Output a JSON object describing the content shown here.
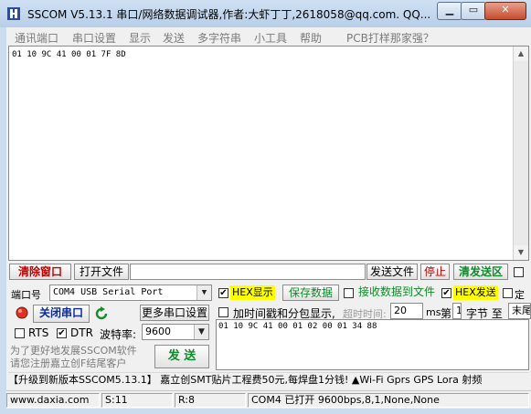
{
  "window": {
    "title": "SSCOM V5.13.1 串口/网络数据调试器,作者:大虾丁丁,2618058@qq.com. QQ...",
    "minimize_icon": "minimize-icon",
    "maximize_icon": "maximize-icon",
    "close_icon": "close-icon"
  },
  "menu": [
    "通讯端口",
    "串口设置",
    "显示",
    "发送",
    "多字符串",
    "小工具",
    "帮助",
    "PCB打样那家强？"
  ],
  "receive": {
    "content": "01 10 9C 41 00 01 7F 8D"
  },
  "toolbar": {
    "clear_window": "清除窗口",
    "open_file": "打开文件",
    "file_path": "",
    "send_file": "发送文件",
    "stop": "停止",
    "clear_send": "清发送区"
  },
  "port": {
    "label": "端口号",
    "value": "COM4 USB Serial Port",
    "close_port": "关闭串口",
    "more_settings": "更多串口设置",
    "rts_label": "RTS",
    "rts_checked": false,
    "dtr_label": "DTR",
    "dtr_checked": true,
    "baud_label": "波特率:",
    "baud_value": "9600"
  },
  "display_options": {
    "hex_display": "HEX显示",
    "hex_display_checked": true,
    "save_data": "保存数据",
    "recv_to_file": "接收数据到文件",
    "recv_to_file_checked": false,
    "hex_send": "HEX发送",
    "hex_send_checked": true,
    "timed_label": "定",
    "timestamp_label": "加时间戳和分包显示,",
    "timestamp_checked": false,
    "timeout_label": "超时时间:",
    "timeout_value": "20",
    "timeout_unit": "ms",
    "nth_label": "第",
    "nth_value": "1",
    "byte_label": "字节 至",
    "end_label": "末尾"
  },
  "send": {
    "content": "01 10 9C 41 00 01 02 00 01 34 88",
    "send_button": "发 送"
  },
  "promo": {
    "line1": "为了更好地发展SSCOM软件",
    "line2": "请您注册嘉立创F结尾客户"
  },
  "ticker": {
    "text": "【升级到新版本SSCOM5.13.1】      嘉立创SMT贴片工程费50元,每焊盘1分钱!  ▲Wi-Fi Gprs GPS Lora 射频"
  },
  "status": {
    "website": "www.daxia.com",
    "sent": "S:11",
    "received": "R:8",
    "port_state": "COM4 已打开  9600bps,8,1,None,None"
  },
  "colors": {
    "frame": "#cbdcee",
    "hex_highlight": "#ffff00",
    "red_button": "#c00000",
    "green_button": "#108a2a"
  }
}
